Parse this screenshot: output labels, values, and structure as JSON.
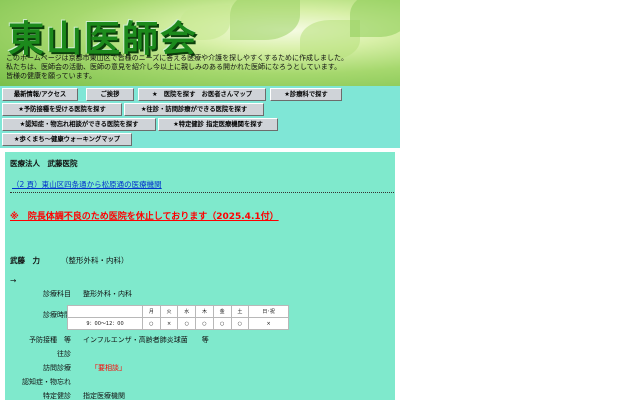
{
  "site": {
    "title": "東山医師会",
    "intro": [
      "このホームページは京都市東山区で皆様のニーズに答える医療や介護を探しやすくするために作成しました。",
      "私たちは、医師会の活動、医師の意見を紹介し今以上に親しみのある開かれた医師になろうとしています。",
      "皆様の健康を願っています。"
    ]
  },
  "nav": {
    "items": [
      "最新情報/アクセス",
      "ご挨拶",
      "★　医院を探す　お医者さんマップ",
      "★診療科で探す",
      "★予防接種を受ける医院を探す",
      "★往診・訪問診療ができる医院を探す",
      "★認知症・物忘れ相談ができる医院を探す",
      "★特定健診 指定医療機関を探す",
      "★歩くまち〜健康ウォーキングマップ"
    ]
  },
  "clinic": {
    "label": "医療法人　武藤医院",
    "route_link": "（2 頁）東山区四条通から松原通の医療機関",
    "notice": "※　院長体調不良のため医院を休止しております（2025.4.1付）",
    "doctor_name": "武藤　力",
    "doctor_dept": "（整形外科・内科）",
    "arrow": "→",
    "departments_label": "診療科目",
    "departments_value": "整形外科・内科",
    "hours_label": "診療時間",
    "days": [
      "月",
      "火",
      "水",
      "木",
      "金",
      "土",
      "日･祝"
    ],
    "hours_slot": "9：00〜12：00",
    "hours_marks": [
      "○",
      "×",
      "○",
      "○",
      "○",
      "○",
      "×"
    ],
    "vaccination_label": "予防接種　等",
    "vaccination_value": "インフルエンザ・高齢者肺炎球菌　　等",
    "visit_label": "往診",
    "home_care_label": "訪問診療",
    "home_care_value": "「要相談」",
    "dementia_label": "認知症・物忘れ",
    "checkup_label": "特定健診",
    "checkup_value": "指定医療機関"
  },
  "colors": {
    "nav_background": "#7fe6d6",
    "content_background": "#7fe9cc",
    "title_green": "#1c8a1c",
    "notice_red": "#ff0000",
    "link_blue": "#0033cc"
  }
}
